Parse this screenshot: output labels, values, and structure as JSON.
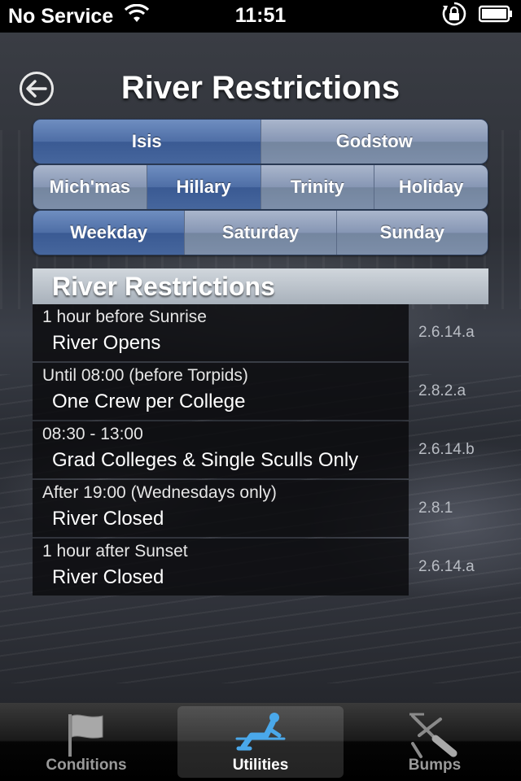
{
  "status_bar": {
    "carrier": "No Service",
    "time": "11:51"
  },
  "header": {
    "title": "River Restrictions"
  },
  "river_selector": {
    "options": [
      "Isis",
      "Godstow"
    ],
    "selected": "Isis"
  },
  "term_selector": {
    "options": [
      "Mich'mas",
      "Hillary",
      "Trinity",
      "Holiday"
    ],
    "selected": "Hillary"
  },
  "day_selector": {
    "options": [
      "Weekday",
      "Saturday",
      "Sunday"
    ],
    "selected": "Weekday"
  },
  "section": {
    "title": "River Restrictions"
  },
  "restrictions": [
    {
      "time": "1 hour before Sunrise",
      "rule": "River Opens",
      "ref": "2.6.14.a"
    },
    {
      "time": "Until 08:00 (before Torpids)",
      "rule": "One Crew per College",
      "ref": "2.8.2.a"
    },
    {
      "time": "08:30 - 13:00",
      "rule": "Grad Colleges & Single Sculls Only",
      "ref": "2.6.14.b"
    },
    {
      "time": "After 19:00 (Wednesdays only)",
      "rule": "River Closed",
      "ref": "2.8.1"
    },
    {
      "time": "1 hour after Sunset",
      "rule": "River Closed",
      "ref": "2.6.14.a"
    }
  ],
  "tab_bar": {
    "tabs": [
      {
        "label": "Conditions",
        "icon": "flag-icon"
      },
      {
        "label": "Utilities",
        "icon": "rower-icon"
      },
      {
        "label": "Bumps",
        "icon": "oars-icon"
      }
    ],
    "selected": "Utilities"
  },
  "colors": {
    "segment_selected": "#4e6ea6",
    "segment_normal": "#8696b4",
    "accent_blue": "#4aa8ea"
  }
}
